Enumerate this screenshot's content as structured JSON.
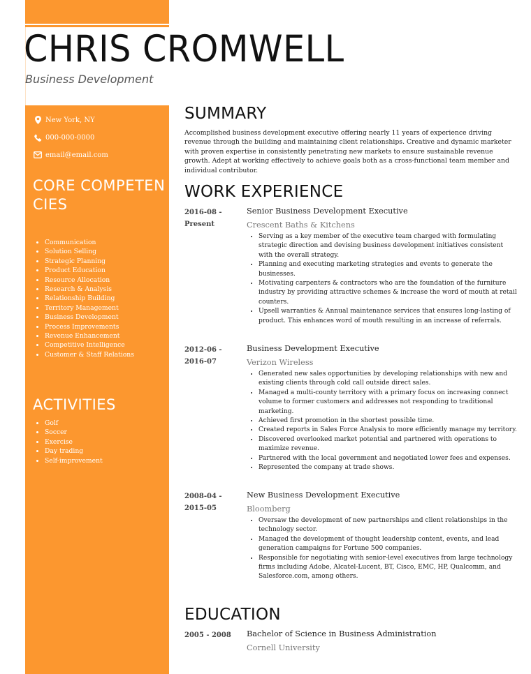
{
  "header": {
    "name": "CHRIS CROMWELL",
    "role": "Business Development"
  },
  "colors": {
    "accent": "#fc972f",
    "text": "#222222",
    "muted": "#777777"
  },
  "contact": {
    "location": {
      "icon": "map-pin-icon",
      "text": "New York, NY"
    },
    "phone": {
      "icon": "phone-icon",
      "text": "000-000-0000"
    },
    "email": {
      "icon": "envelope-icon",
      "text": "email@email.com"
    }
  },
  "competencies": {
    "heading": "CORE COMPETENCIES",
    "items": [
      "Communication",
      "Solution Selling",
      "Strategic Planning",
      "Product Education",
      "Resource Allocation",
      "Research & Analysis",
      "Relationship Building",
      "Territory Management",
      "Business Development",
      "Process Improvements",
      "Revenue Enhancement",
      "Competitive Intelligence",
      "Customer & Staff Relations"
    ]
  },
  "activities": {
    "heading": "ACTIVITIES",
    "items": [
      "Golf",
      "Soccer",
      "Exercise",
      "Day trading",
      "Self-improvement"
    ]
  },
  "summary": {
    "heading": "SUMMARY",
    "text": "Accomplished business development executive offering nearly 11 years of experience driving revenue through the building and maintaining client relationships. Creative and dynamic marketer with proven expertise in consistently penetrating new markets to ensure sustainable revenue growth. Adept at working effectively to achieve goals both as a cross-functional team member and individual contributor."
  },
  "experience": {
    "heading": "WORK EXPERIENCE",
    "jobs": [
      {
        "dates_start": "2016-08 -",
        "dates_end": "Present",
        "title": "Senior Business Development Executive",
        "company": "Crescent Baths & Kitchens",
        "bullets": [
          "Serving as a key member of the executive team charged with formulating strategic direction and devising business development initiatives consistent with the overall strategy.",
          "Planning and executing marketing strategies and events to generate the businesses.",
          "Motivating carpenters & contractors who are the foundation of the furniture industry by providing attractive schemes & increase the word of mouth at retail counters.",
          "Upsell warranties & Annual maintenance services that ensures long-lasting of product. This enhances word of mouth resulting in an increase of referrals."
        ]
      },
      {
        "dates_start": "2012-06 -",
        "dates_end": "2016-07",
        "title": "Business Development Executive",
        "company": "Verizon Wireless",
        "bullets": [
          "Generated new sales opportunities by developing relationships with new and existing clients through cold call outside direct sales.",
          "Managed a multi-county territory with a primary focus on increasing connect volume to former customers and addresses not responding to traditional marketing.",
          "Achieved first promotion in the shortest possible time.",
          "Created reports in Sales Force Analysis to more efficiently manage my territory.",
          "Discovered overlooked market potential and partnered with operations to maximize revenue.",
          "Partnered with the local government and negotiated lower fees and expenses.",
          "Represented the company at trade shows."
        ]
      },
      {
        "dates_start": "2008-04 -",
        "dates_end": "2015-05",
        "title": "New Business Development Executive",
        "company": "Bloomberg",
        "bullets": [
          "Oversaw the development of new partnerships and client relationships in the technology sector.",
          "Managed the development of thought leadership content, events, and lead generation campaigns for Fortune 500 companies.",
          "Responsible for negotiating with senior-level executives from large technology firms including Adobe, Alcatel-Lucent, BT, Cisco, EMC, HP, Qualcomm, and Salesforce.com, among others."
        ]
      }
    ]
  },
  "education": {
    "heading": "EDUCATION",
    "dates": "2005 - 2008",
    "degree": "Bachelor of Science in Business Administration",
    "school": "Cornell University"
  }
}
